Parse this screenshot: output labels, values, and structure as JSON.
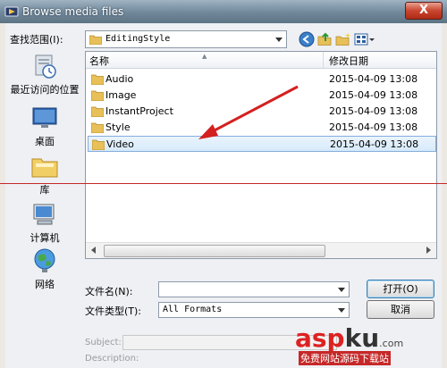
{
  "window": {
    "title": "Browse media files",
    "close_glyph": "X"
  },
  "lookin": {
    "label": "查找范围(I):",
    "value": "EditingStyle"
  },
  "places": [
    {
      "label": "最近访问的位置",
      "icon": "recent-places-icon"
    },
    {
      "label": "桌面",
      "icon": "desktop-icon"
    },
    {
      "label": "库",
      "icon": "libraries-icon"
    },
    {
      "label": "计算机",
      "icon": "computer-icon"
    },
    {
      "label": "网络",
      "icon": "network-icon"
    }
  ],
  "list": {
    "columns": {
      "name": "名称",
      "date": "修改日期"
    },
    "rows": [
      {
        "name": "Audio",
        "date": "2015-04-09 13:08",
        "selected": false
      },
      {
        "name": "Image",
        "date": "2015-04-09 13:08",
        "selected": false
      },
      {
        "name": "InstantProject",
        "date": "2015-04-09 13:08",
        "selected": false
      },
      {
        "name": "Style",
        "date": "2015-04-09 13:08",
        "selected": false
      },
      {
        "name": "Video",
        "date": "2015-04-09 13:08",
        "selected": true
      }
    ]
  },
  "filename": {
    "label": "文件名(N):",
    "value": ""
  },
  "filetype": {
    "label": "文件类型(T):",
    "value": "All Formats"
  },
  "buttons": {
    "open": "打开(O)",
    "cancel": "取消"
  },
  "meta": {
    "subject_label": "Subject:",
    "description_label": "Description:"
  },
  "watermark": {
    "asp": "asp",
    "ku": "ku",
    "com": ".com",
    "sub": "免费网站源码下载站"
  },
  "colors": {
    "accent": "#3c7fb1",
    "folder": "#e8c05a",
    "annotation": "#d42020"
  }
}
